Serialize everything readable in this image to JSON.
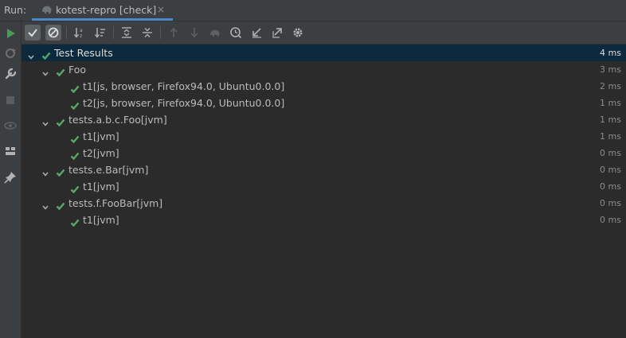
{
  "header": {
    "run_label": "Run:",
    "tab": {
      "title": "kotest-repro [check]",
      "close": "×"
    }
  },
  "left_toolbar": {
    "icons": [
      "run-icon",
      "rerun-failed-icon",
      "wrench-icon",
      "stop-icon",
      "eye-icon",
      "layout-icon",
      "pin-icon"
    ]
  },
  "toolbar": {
    "icons": [
      "show-passed-icon",
      "show-ignored-icon",
      "sort-alpha-icon",
      "sort-duration-icon",
      "expand-all-icon",
      "collapse-all-icon",
      "prev-failed-icon",
      "next-failed-icon",
      "rerun-icon",
      "history-icon",
      "import-icon",
      "export-icon",
      "settings-icon"
    ]
  },
  "tree": {
    "root": {
      "label": "Test Results",
      "time": "4 ms"
    },
    "groups": [
      {
        "label": "Foo",
        "time": "3 ms",
        "children": [
          {
            "label": "t1[js, browser, Firefox94.0, Ubuntu0.0.0]",
            "time": "2 ms"
          },
          {
            "label": "t2[js, browser, Firefox94.0, Ubuntu0.0.0]",
            "time": "1 ms"
          }
        ]
      },
      {
        "label": "tests.a.b.c.Foo[jvm]",
        "time": "1 ms",
        "children": [
          {
            "label": "t1[jvm]",
            "time": "1 ms"
          },
          {
            "label": "t2[jvm]",
            "time": "0 ms"
          }
        ]
      },
      {
        "label": "tests.e.Bar[jvm]",
        "time": "0 ms",
        "children": [
          {
            "label": "t1[jvm]",
            "time": "0 ms"
          }
        ]
      },
      {
        "label": "tests.f.FooBar[jvm]",
        "time": "0 ms",
        "children": [
          {
            "label": "t1[jvm]",
            "time": "0 ms"
          }
        ]
      }
    ]
  },
  "colors": {
    "pass": "#59a869",
    "selection": "#0d293e",
    "tab_accent": "#4a88c7"
  }
}
